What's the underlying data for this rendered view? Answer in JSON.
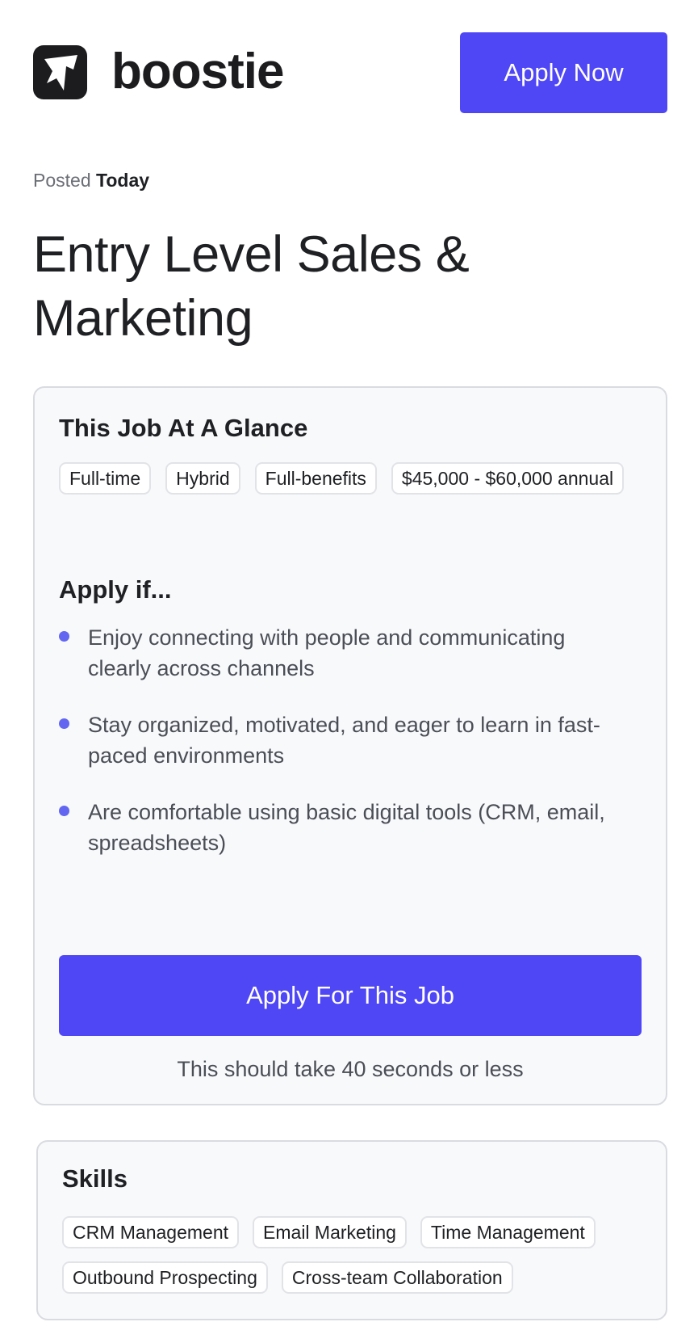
{
  "header": {
    "brand": "boostie",
    "logo_icon": "boostie-logo-icon",
    "apply_now_label": "Apply Now"
  },
  "posted": {
    "prefix": "Posted",
    "value": "Today"
  },
  "job": {
    "title": "Entry Level Sales & Marketing"
  },
  "glance": {
    "heading": "This Job At A Glance",
    "tags": [
      "Full-time",
      "Hybrid",
      "Full-benefits",
      "$45,000 - $60,000 annual"
    ],
    "apply_if_heading": "Apply if...",
    "bullets": [
      "Enjoy connecting with people and communicating clearly across channels",
      "Stay organized, motivated, and eager to learn in fast-paced environments",
      "Are comfortable using basic digital tools (CRM, email, spreadsheets)"
    ],
    "apply_button_label": "Apply For This Job",
    "note": "This should take 40 seconds or less"
  },
  "skills": {
    "heading": "Skills",
    "tags": [
      "CRM Management",
      "Email Marketing",
      "Time Management",
      "Outbound Prospecting",
      "Cross-team Collaboration"
    ]
  },
  "colors": {
    "accent": "#4f46f5",
    "bullet_dot": "#6366f1",
    "card_background": "#f8f9fb",
    "logo_background": "#1c1c1f"
  }
}
